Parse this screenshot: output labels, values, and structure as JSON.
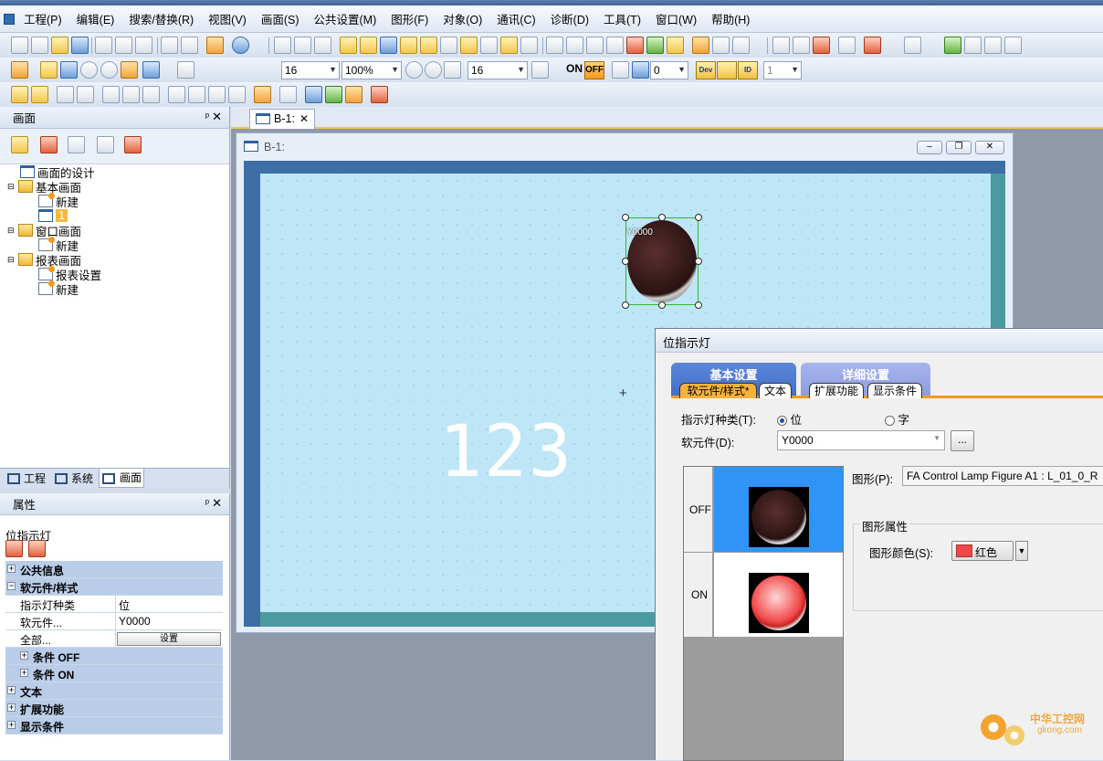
{
  "menu": {
    "items": [
      "工程(P)",
      "编辑(E)",
      "搜索/替换(R)",
      "视图(V)",
      "画面(S)",
      "公共设置(M)",
      "图形(F)",
      "对象(O)",
      "通讯(C)",
      "诊断(D)",
      "工具(T)",
      "窗口(W)",
      "帮助(H)"
    ]
  },
  "toolbar": {
    "font_size": "16",
    "zoom": "100%",
    "grid_size": "16",
    "on_label": "ON",
    "off_label": "OFF",
    "state_value": "0",
    "dev_label": "Dev",
    "id_label": "ID",
    "layer_value": "1"
  },
  "screen_panel": {
    "title": "画面",
    "pin": "ᵖ",
    "tree": {
      "design": "画面的设计",
      "base_screen": "基本画面",
      "base_new": "新建",
      "base_item": "1",
      "window_screen": "窗口画面",
      "window_new": "新建",
      "report_screen": "报表画面",
      "report_settings": "报表设置",
      "report_new": "新建"
    },
    "tabs": [
      "工程",
      "系统",
      "画面"
    ]
  },
  "properties_panel": {
    "title": "属性",
    "object_name": "位指示灯",
    "rows": {
      "common": "公共信息",
      "device_style": "软元件/样式",
      "lamp_type_key": "指示灯种类",
      "lamp_type_val": "位",
      "device_key": "软元件...",
      "device_val": "Y0000",
      "all_key": "全部...",
      "all_btn": "设置",
      "cond_off": "条件 OFF",
      "cond_on": "条件 ON",
      "text": "文本",
      "extended": "扩展功能",
      "display_cond": "显示条件"
    }
  },
  "editor": {
    "tab_label": "B-1:",
    "window_title": "B-1:",
    "canvas_text": "123",
    "lamp_label": "Y0000"
  },
  "dialog": {
    "title": "位指示灯",
    "tab_basic": "基本设置",
    "tab_detail": "详细设置",
    "sub_device_style": "软元件/样式*",
    "sub_text": "文本",
    "sub_extended": "扩展功能",
    "sub_display": "显示条件",
    "lamp_type_label": "指示灯种类(T):",
    "radio_bit": "位",
    "radio_word": "字",
    "device_label": "软元件(D):",
    "device_value": "Y0000",
    "browse_btn": "...",
    "state_off": "OFF",
    "state_on": "ON",
    "shape_label": "图形(P):",
    "shape_value": "FA Control Lamp Figure A1 : L_01_0_R",
    "shape_attr_group": "图形属性",
    "shape_color_label": "图形颜色(S):",
    "shape_color_value": "红色"
  },
  "watermark": {
    "cn": "中华工控网",
    "en": "gkong.com"
  },
  "colors": {
    "canvas_bg": "#bfe6f6",
    "frame_blue": "#3d6fa6",
    "frame_teal": "#4a9aa0",
    "dialog_tab_blue": "#3f6fc7",
    "dialog_tab_lilac": "#8a9be0",
    "highlight_blue": "#2f94f5",
    "lamp_on_red": "#f04848"
  }
}
